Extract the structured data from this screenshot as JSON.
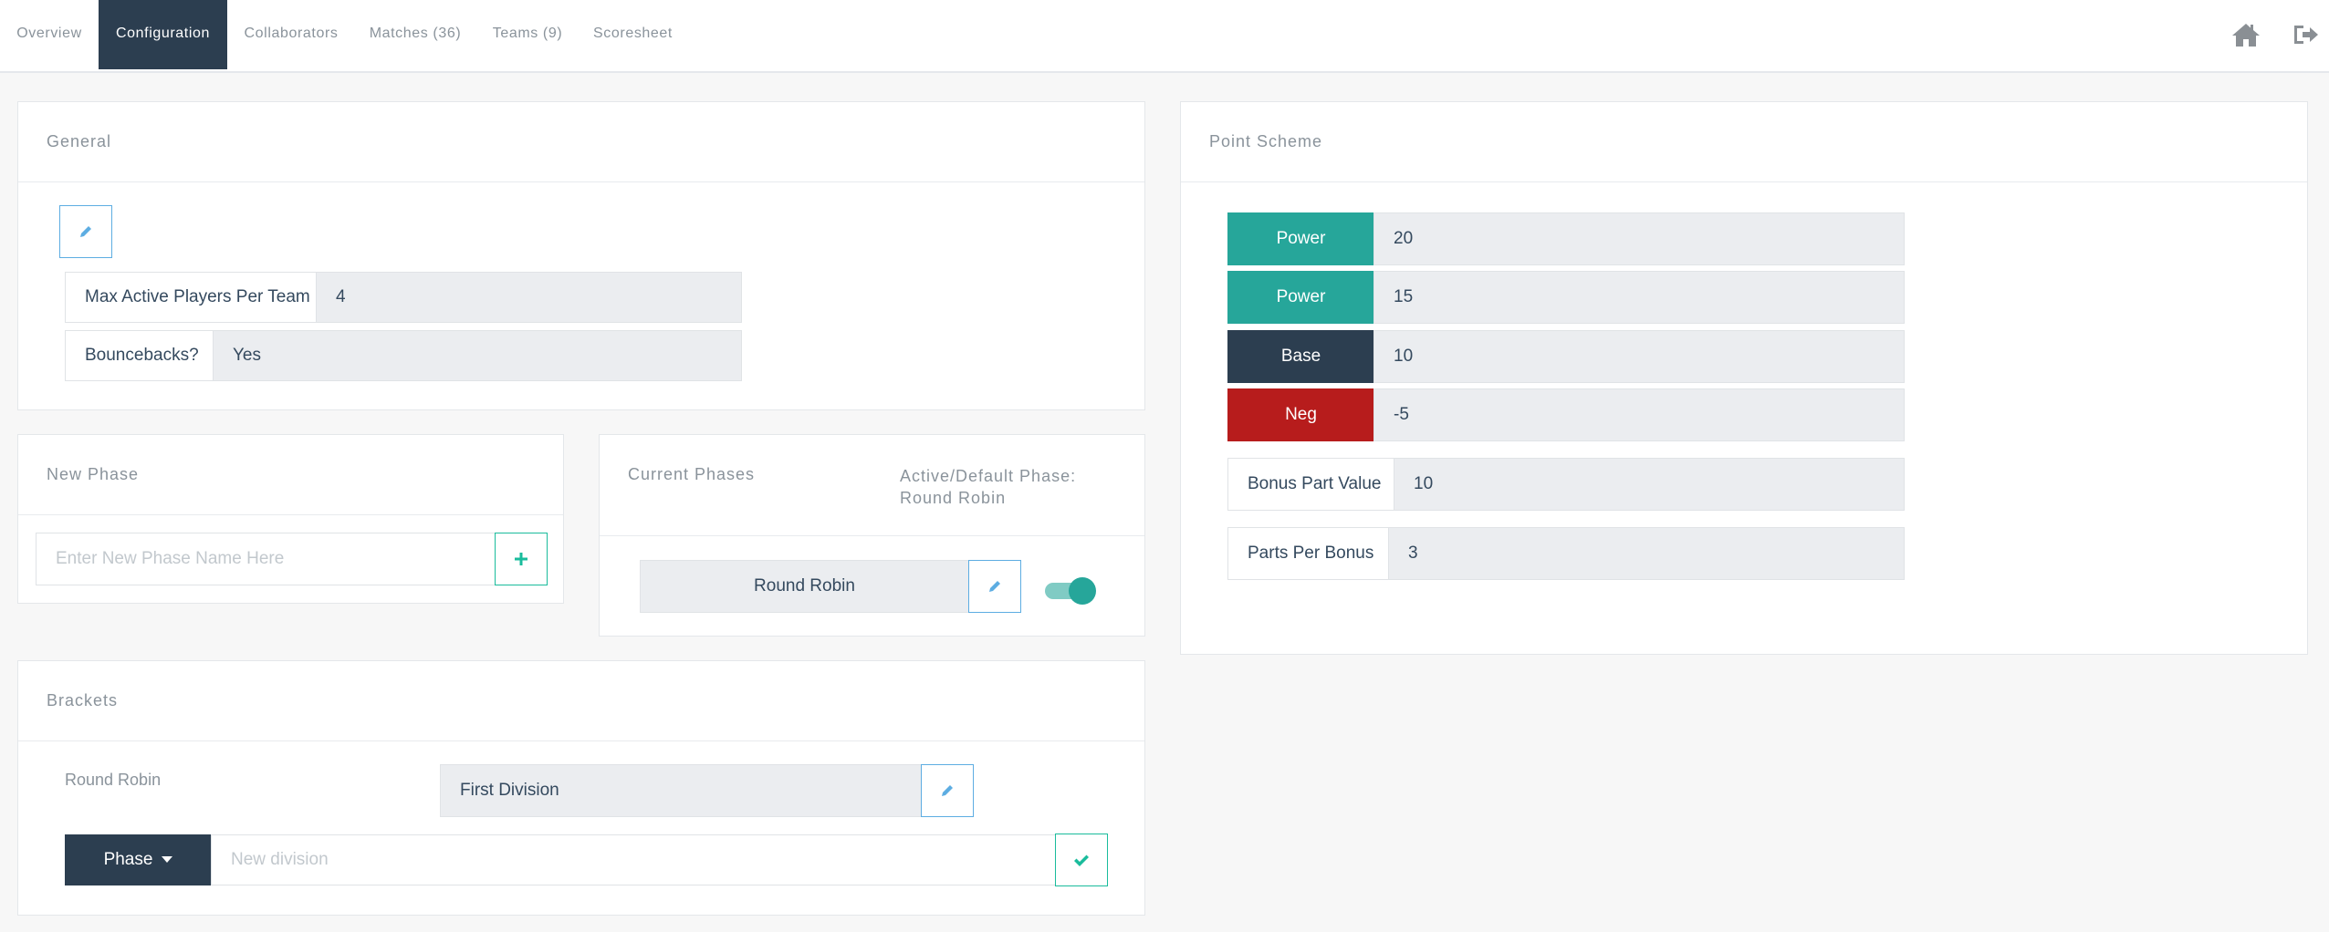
{
  "nav": {
    "tabs": [
      {
        "label": "Overview"
      },
      {
        "label": "Configuration"
      },
      {
        "label": "Collaborators"
      },
      {
        "label": "Matches (36)"
      },
      {
        "label": "Teams (9)"
      },
      {
        "label": "Scoresheet"
      }
    ],
    "active_tab": "Configuration",
    "icons": [
      "home-icon",
      "sign-out-icon"
    ]
  },
  "general": {
    "title": "General",
    "max_players_label": "Max Active Players Per Team",
    "max_players_value": "4",
    "bouncebacks_label": "Bouncebacks?",
    "bouncebacks_value": "Yes"
  },
  "new_phase": {
    "title": "New Phase",
    "placeholder": "Enter New Phase Name Here"
  },
  "current_phases": {
    "title": "Current Phases",
    "active_label": "Active/Default Phase:",
    "active_value": "Round Robin",
    "phases": [
      {
        "name": "Round Robin",
        "active": true
      }
    ]
  },
  "brackets": {
    "title": "Brackets",
    "phase_name": "Round Robin",
    "division": "First Division",
    "phase_dropdown_label": "Phase",
    "new_division_placeholder": "New division"
  },
  "point_scheme": {
    "title": "Point Scheme",
    "tossups": [
      {
        "label": "Power",
        "value": "20",
        "color": "#26a69a"
      },
      {
        "label": "Power",
        "value": "15",
        "color": "#26a69a"
      },
      {
        "label": "Base",
        "value": "10",
        "color": "#2c3e50"
      },
      {
        "label": "Neg",
        "value": "-5",
        "color": "#b71c1c"
      }
    ],
    "bonus_part_label": "Bonus Part Value",
    "bonus_part_value": "10",
    "parts_per_bonus_label": "Parts Per Bonus",
    "parts_per_bonus_value": "3"
  },
  "colors": {
    "accent_dark": "#2c3e50",
    "teal": "#26a69a",
    "neg_red": "#b71c1c",
    "edit_blue": "#5dade2"
  }
}
